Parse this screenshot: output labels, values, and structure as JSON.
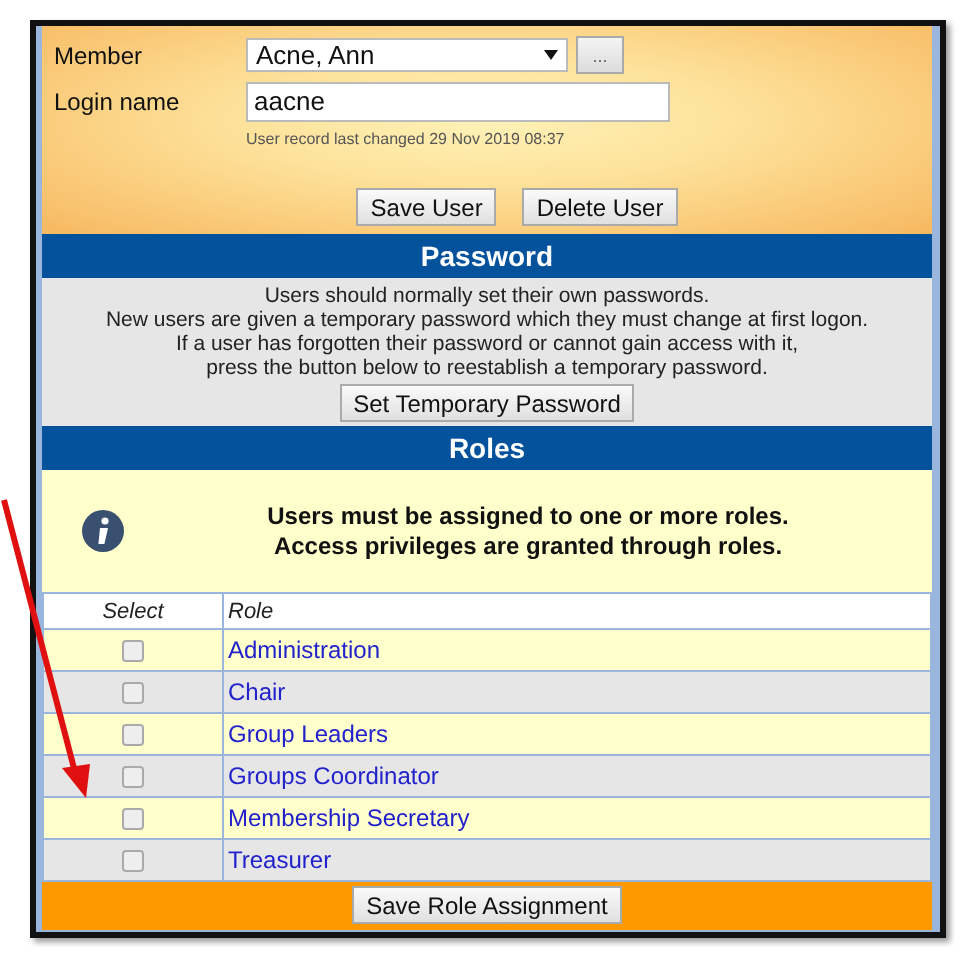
{
  "user_form": {
    "member_label": "Member",
    "member_value": "Acne, Ann",
    "member_lookup_button": "...",
    "login_label": "Login name",
    "login_value": "aacne",
    "last_changed": "User record last changed 29 Nov 2019 08:37",
    "buttons": [
      "Save User",
      "Delete User"
    ]
  },
  "password": {
    "title": "Password",
    "lines": [
      "Users should normally set their own passwords.",
      "New users are given a temporary password which they must change at first logon.",
      "If a user has forgotten their password or cannot gain access with it,",
      "press the button below to reestablish a temporary password."
    ],
    "button": "Set Temporary Password"
  },
  "roles": {
    "title": "Roles",
    "info_lines": [
      "Users must be assigned to one or more roles.",
      "Access privileges are granted through roles."
    ],
    "columns": [
      "Select",
      "Role"
    ],
    "rows": [
      {
        "role": "Administration",
        "checked": false
      },
      {
        "role": "Chair",
        "checked": false
      },
      {
        "role": "Group Leaders",
        "checked": false
      },
      {
        "role": "Groups Coordinator",
        "checked": false
      },
      {
        "role": "Membership Secretary",
        "checked": false
      },
      {
        "role": "Treasurer",
        "checked": false
      }
    ],
    "save_button": "Save Role Assignment"
  }
}
